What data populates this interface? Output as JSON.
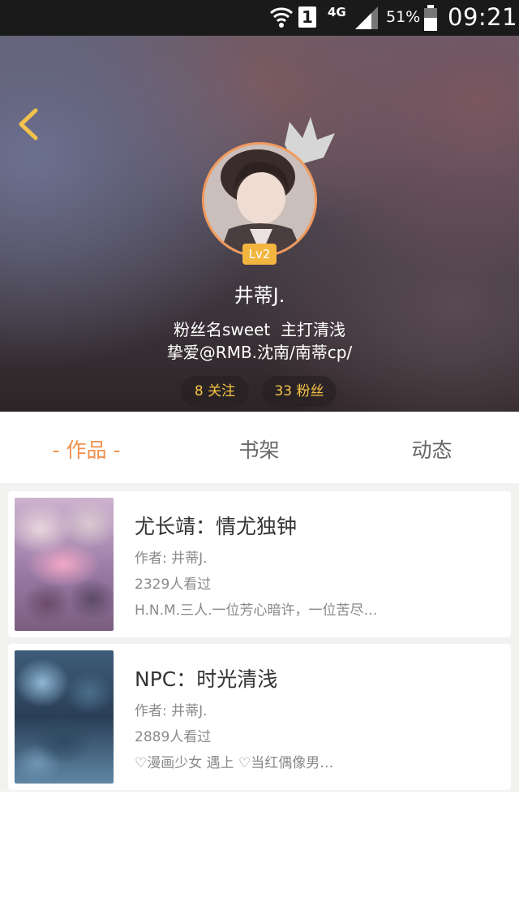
{
  "status_bar": {
    "network": "4G",
    "sim_slot": "1",
    "battery_percent": "51%",
    "time": "09:21"
  },
  "profile": {
    "level": "Lv2",
    "name": "井蒂J.",
    "bio_line1": "粉丝名sweet  主打清浅",
    "bio_line2": "挚爱@RMB.沈南/南蒂cp/",
    "following_label": "8 关注",
    "fans_label": "33 粉丝"
  },
  "tabs": [
    {
      "label": "- 作品 -",
      "active": true
    },
    {
      "label": "书架",
      "active": false
    },
    {
      "label": "动态",
      "active": false
    }
  ],
  "works": [
    {
      "title": "尤长靖：情尤独钟",
      "author": "作者: 井蒂J.",
      "views": "2329人看过",
      "description": "H.N.M.三人.一位芳心暗许，一位苦尽…"
    },
    {
      "title": "NPC：时光清浅",
      "author": "作者: 井蒂J.",
      "views": "2889人看过",
      "description": "♡漫画少女 遇上 ♡当红偶像男…"
    }
  ],
  "colors": {
    "accent": "#f0904c",
    "badge": "#f2b640",
    "stat_text": "#f6c445",
    "back_arrow": "#f2c24c"
  },
  "icons": {
    "back": "chevron-left-icon",
    "crown": "crown-icon",
    "wifi": "wifi-icon",
    "signal": "signal-icon",
    "battery": "battery-icon"
  }
}
